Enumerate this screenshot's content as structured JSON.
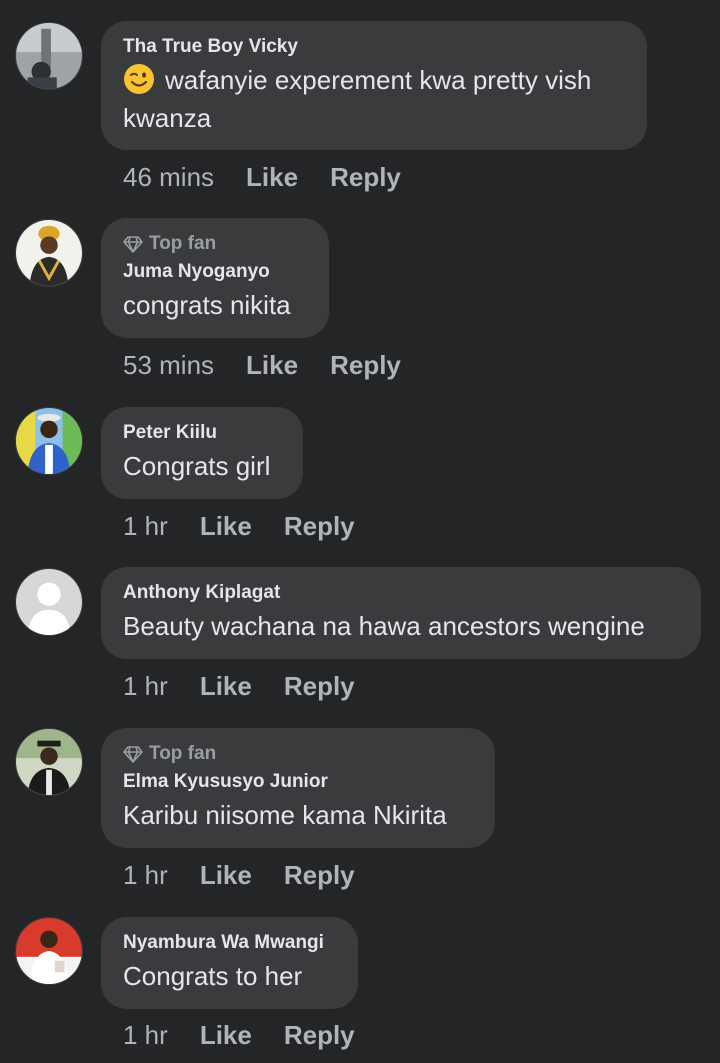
{
  "comments": [
    {
      "author": "Tha True Boy Vicky",
      "top_fan": false,
      "has_emoji": true,
      "emoji_icon": "winking-face-icon",
      "text": "wafanyie experement kwa pretty vish kwanza",
      "time": "46 mins",
      "like": "Like",
      "reply": "Reply"
    },
    {
      "author": "Juma Nyoganyo",
      "top_fan": true,
      "badge": "Top fan",
      "text": "congrats nikita",
      "time": "53 mins",
      "like": "Like",
      "reply": "Reply"
    },
    {
      "author": "Peter Kiilu",
      "top_fan": false,
      "text": "Congrats girl",
      "time": "1 hr",
      "like": "Like",
      "reply": "Reply"
    },
    {
      "author": "Anthony Kiplagat",
      "top_fan": false,
      "text": "Beauty wachana na hawa ancestors wengine",
      "time": "1 hr",
      "like": "Like",
      "reply": "Reply"
    },
    {
      "author": "Elma Kyususyo Junior",
      "top_fan": true,
      "badge": "Top fan",
      "text": "Karibu niisome kama Nkirita",
      "time": "1 hr",
      "like": "Like",
      "reply": "Reply"
    },
    {
      "author": "Nyambura Wa Mwangi",
      "top_fan": false,
      "text": "Congrats to her",
      "time": "1 hr",
      "like": "Like",
      "reply": "Reply"
    }
  ],
  "colors": {
    "background": "#242526",
    "bubble": "#3a3b3c",
    "primary_text": "#e4e6eb",
    "secondary_text": "#b0b3b8"
  }
}
